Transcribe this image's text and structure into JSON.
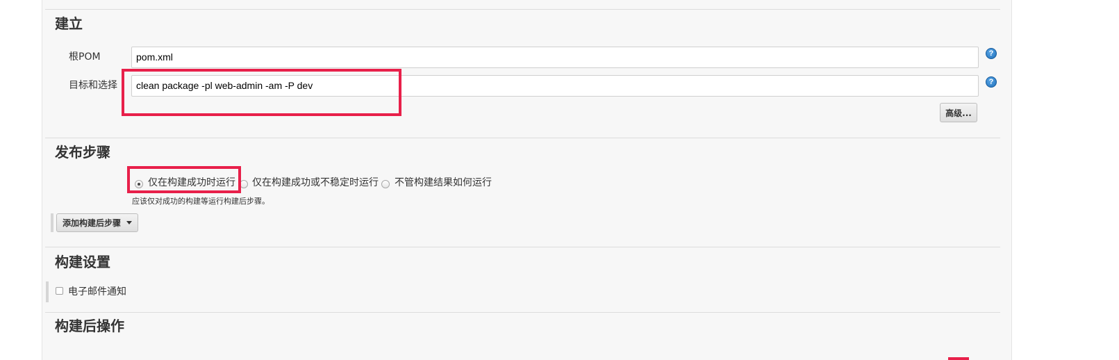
{
  "build_section": {
    "title": "建立",
    "root_pom_label": "根POM",
    "root_pom_value": "pom.xml",
    "goals_label": "目标和选择",
    "goals_value": "clean package -pl web-admin -am -P dev",
    "advanced_button": "高级...",
    "help_icon_glyph": "?"
  },
  "post_steps_section": {
    "title": "发布步骤",
    "options": [
      {
        "label": "仅在构建成功时运行",
        "checked": true
      },
      {
        "label": "仅在构建成功或不稳定时运行",
        "checked": false
      },
      {
        "label": "不管构建结果如何运行",
        "checked": false
      }
    ],
    "hint": "应该仅对成功的构建等运行构建后步骤。",
    "add_step_button": "添加构建后步骤"
  },
  "build_settings_section": {
    "title": "构建设置",
    "email_notification_label": "电子邮件通知",
    "email_notification_checked": false
  },
  "post_build_section": {
    "title": "构建后操作"
  },
  "colors": {
    "panel_background": "#f7f7f7",
    "highlight_box": "#e8204a",
    "help_icon": "#1f6fb8"
  }
}
